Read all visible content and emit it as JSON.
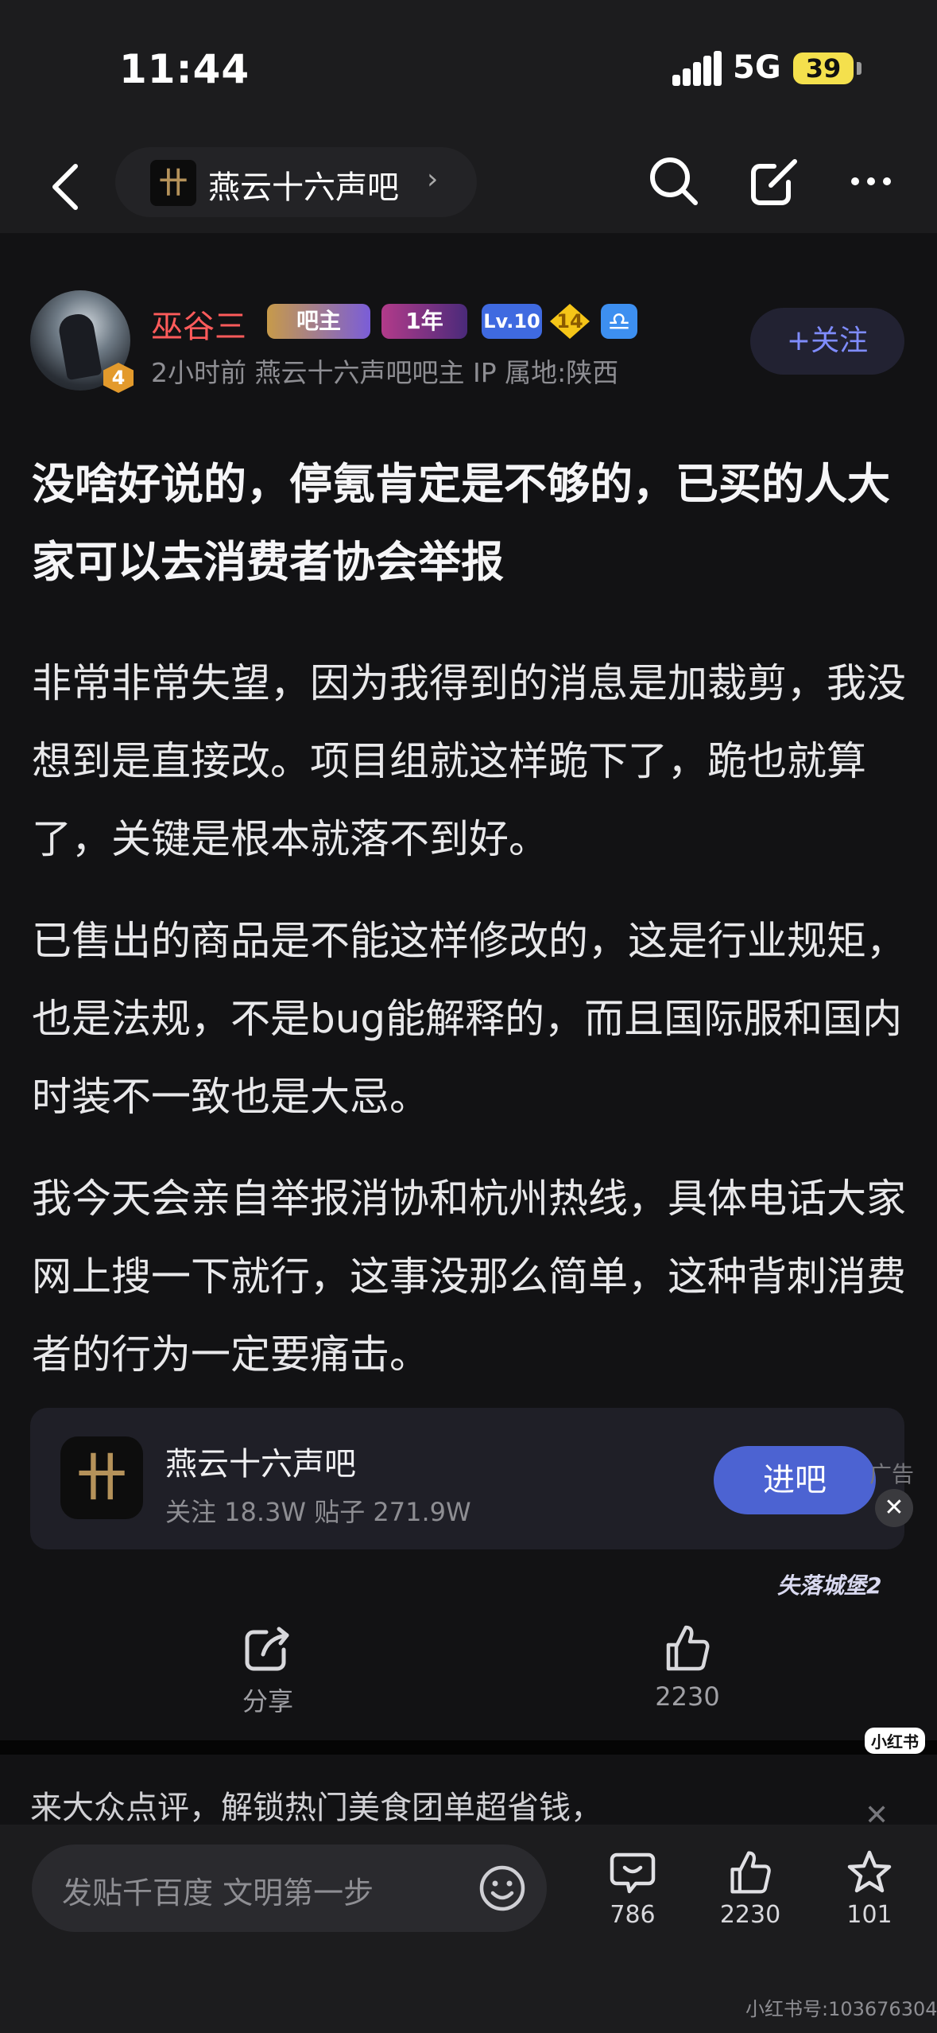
{
  "status_bar": {
    "time": "11:44",
    "network": "5G",
    "battery": "39"
  },
  "nav": {
    "forum_name": "燕云十六声吧",
    "forum_logo_text": "卄"
  },
  "post": {
    "author": "巫谷三",
    "avatar_level": "4",
    "badges": {
      "owner": "吧主",
      "year": "1年",
      "level": "Lv.10",
      "diamond": "14",
      "zodiac": "♎"
    },
    "meta": "2小时前   燕云十六声吧吧主   IP 属地:陕西",
    "follow_label": "+关注",
    "title": "没啥好说的，停氪肯定是不够的，已买的人大家可以去消费者协会举报",
    "paragraphs": [
      "非常非常失望，因为我得到的消息是加裁剪，我没想到是直接改。项目组就这样跪下了，跪也就算了，关键是根本就落不到好。",
      "已售出的商品是不能这样修改的，这是行业规矩，也是法规，不是bug能解释的，而且国际服和国内时装不一致也是大忌。",
      "我今天会亲自举报消协和杭州热线，具体电话大家网上搜一下就行，这事没那么简单，这种背刺消费者的行为一定要痛击。"
    ]
  },
  "forum_card": {
    "logo_text": "卄",
    "name": "燕云十六声吧",
    "stats": "关注 18.3W   贴子 271.9W",
    "enter_label": "进吧",
    "ad_label": "广告",
    "watermark": "失落城堡2"
  },
  "actions": {
    "share_label": "分享",
    "like_count": "2230"
  },
  "promo": {
    "text": "来大众点评，解锁热门美食团单超省钱，"
  },
  "bottom_bar": {
    "reply_placeholder": "发贴千百度 文明第一步",
    "comments": "786",
    "likes": "2230",
    "favorites": "101"
  },
  "credit": {
    "logo": "小红书",
    "text": "小红书号:103676304"
  },
  "colors": {
    "accent": "#4c63d2",
    "author": "#ff5b5b",
    "background": "#121214"
  }
}
